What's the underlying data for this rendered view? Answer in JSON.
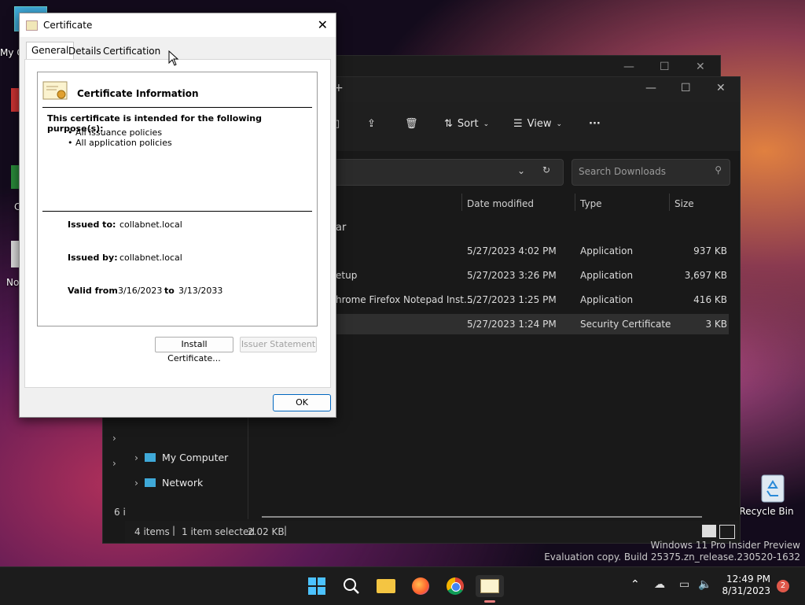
{
  "desktop": {
    "icons": [
      {
        "label": "My C",
        "name": "my-computer-desktop-icon"
      },
      {
        "label": "Recycle Bin",
        "name": "recycle-bin-desktop-icon"
      }
    ],
    "partial_labels": [
      "C",
      "No"
    ]
  },
  "explorer": {
    "toolbar": {
      "sort": "Sort",
      "view": "View",
      "more": "···"
    },
    "search_placeholder": "Search Downloads",
    "group_label": "ar",
    "columns": {
      "date": "Date modified",
      "type": "Type",
      "size": "Size"
    },
    "rows": [
      {
        "name": "",
        "date": "5/27/2023 4:02 PM",
        "type": "Application",
        "size": "937 KB"
      },
      {
        "name": "etup",
        "date": "5/27/2023 3:26 PM",
        "type": "Application",
        "size": "3,697 KB"
      },
      {
        "name": "hrome Firefox Notepad Inst...",
        "date": "5/27/2023 1:25 PM",
        "type": "Application",
        "size": "416 KB"
      },
      {
        "name": "",
        "date": "5/27/2023 1:24 PM",
        "type": "Security Certificate",
        "size": "3 KB"
      }
    ],
    "nav": [
      {
        "label": "My Computer"
      },
      {
        "label": "Network"
      }
    ],
    "status": {
      "items": "4 items",
      "selected": "1 item selected",
      "selected_size": "2.02 KB",
      "side_count": "6 i"
    }
  },
  "certificate": {
    "title": "Certificate",
    "tabs": [
      "General",
      "Details",
      "Certification Path"
    ],
    "active_tab": "General",
    "heading": "Certificate Information",
    "purpose_heading": "This certificate is intended for the following purpose(s):",
    "purposes": [
      "• All issuance policies",
      "• All application policies"
    ],
    "issued_to_label": "Issued to:",
    "issued_to": "collabnet.local",
    "issued_by_label": "Issued by:",
    "issued_by": "collabnet.local",
    "valid_from_label": "Valid from",
    "valid_from": "3/16/2023",
    "valid_to_label": "to",
    "valid_to": "3/13/2033",
    "install_button": "Install Certificate...",
    "issuer_button": "Issuer Statement",
    "ok_button": "OK"
  },
  "taskbar": {
    "time": "12:49 PM",
    "date": "8/31/2023",
    "notification_count": "2"
  },
  "watermark": {
    "line1": "Windows 11 Pro Insider Preview",
    "line2": "Evaluation copy. Build 25375.zn_release.230520-1632"
  }
}
